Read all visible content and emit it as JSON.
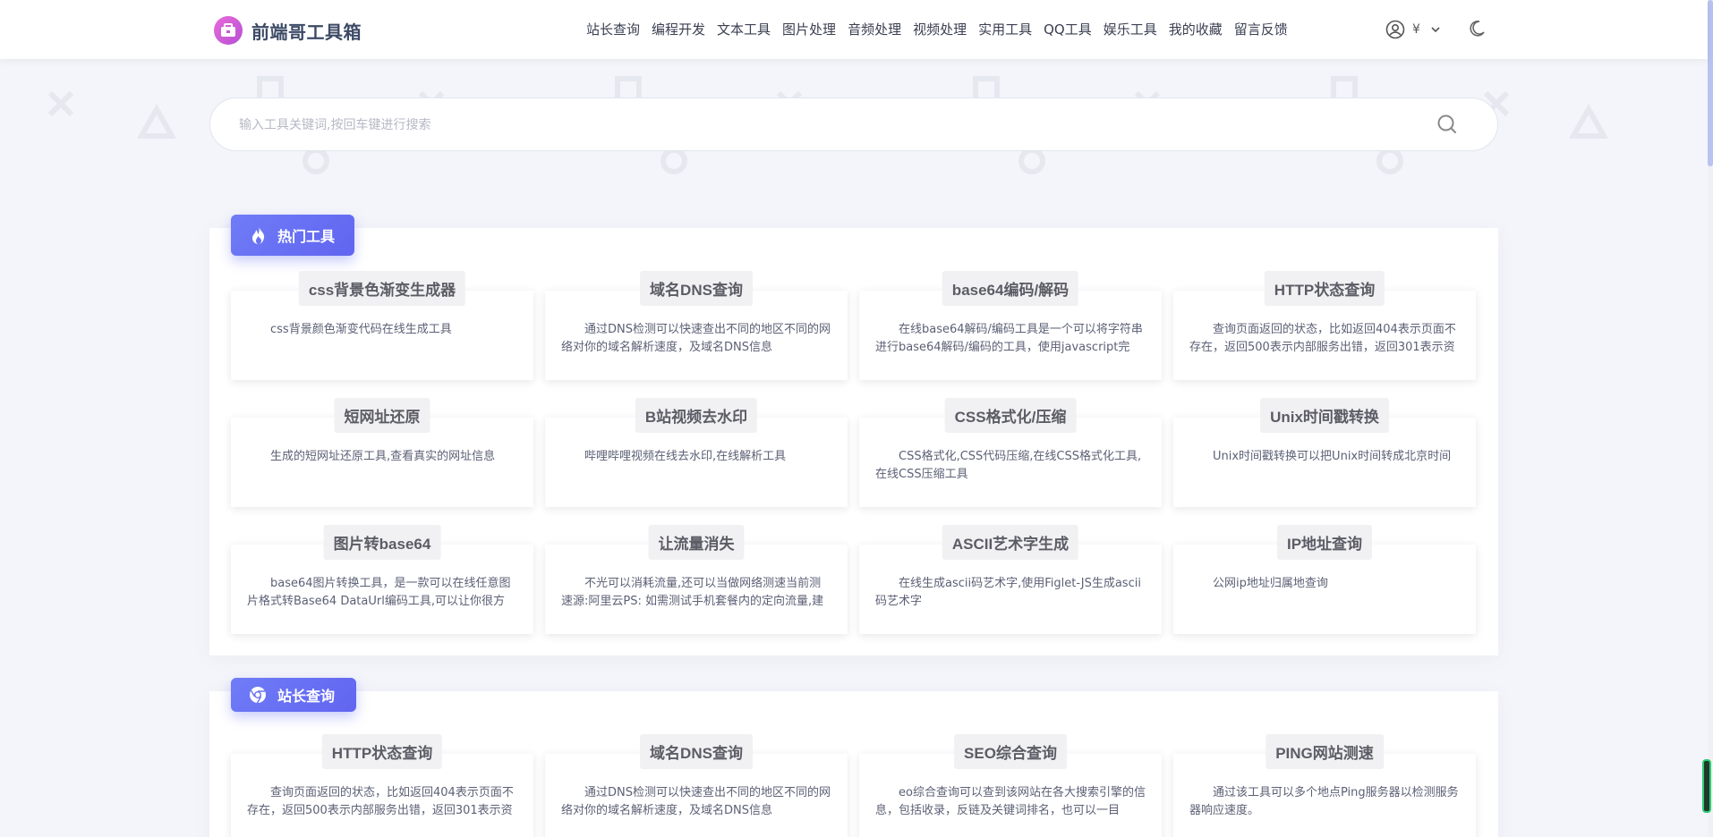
{
  "header": {
    "logo_text": "前端哥工具箱",
    "nav": [
      "站长查询",
      "编程开发",
      "文本工具",
      "图片处理",
      "音频处理",
      "视频处理",
      "实用工具",
      "QQ工具",
      "娱乐工具",
      "我的收藏",
      "留言反馈"
    ],
    "currency": "¥"
  },
  "search": {
    "placeholder": "输入工具关键词,按回车键进行搜索"
  },
  "sections": [
    {
      "title": "热门工具",
      "icon": "fire-icon",
      "cards": [
        {
          "title": "css背景色渐变生成器",
          "desc": "css背景颜色渐变代码在线生成工具"
        },
        {
          "title": "域名DNS查询",
          "desc": "通过DNS检测可以快速查出不同的地区不同的网络对你的域名解析速度，及域名DNS信息"
        },
        {
          "title": "base64编码/解码",
          "desc": "在线base64解码/编码工具是一个可以将字符串进行base64解码/编码的工具，使用javascript完"
        },
        {
          "title": "HTTP状态查询",
          "desc": "查询页面返回的状态，比如返回404表示页面不存在，返回500表示内部服务出错，返回301表示资"
        },
        {
          "title": "短网址还原",
          "desc": "生成的短网址还原工具,查看真实的网址信息"
        },
        {
          "title": "B站视频去水印",
          "desc": "哔哩哔哩视频在线去水印,在线解析工具"
        },
        {
          "title": "CSS格式化/压缩",
          "desc": "CSS格式化,CSS代码压缩,在线CSS格式化工具,在线CSS压缩工具"
        },
        {
          "title": "Unix时间戳转换",
          "desc": "Unix时间戳转换可以把Unix时间转成北京时间"
        },
        {
          "title": "图片转base64",
          "desc": "base64图片转换工具，是一款可以在线任意图片格式转Base64 DataUrl编码工具,可以让你很方"
        },
        {
          "title": "让流量消失",
          "desc": "不光可以消耗流量,还可以当做网络测速当前测速源:阿里云PS: 如需测试手机套餐内的定向流量,建"
        },
        {
          "title": "ASCII艺术字生成",
          "desc": "在线生成ascii码艺术字,使用Figlet-JS生成ascii码艺术字"
        },
        {
          "title": "IP地址查询",
          "desc": "公网ip地址归属地查询"
        }
      ]
    },
    {
      "title": "站长查询",
      "icon": "chrome-icon",
      "cards": [
        {
          "title": "HTTP状态查询",
          "desc": "查询页面返回的状态，比如返回404表示页面不存在，返回500表示内部服务出错，返回301表示资"
        },
        {
          "title": "域名DNS查询",
          "desc": "通过DNS检测可以快速查出不同的地区不同的网络对你的域名解析速度，及域名DNS信息"
        },
        {
          "title": "SEO综合查询",
          "desc": "eo综合查询可以查到该网站在各大搜索引擎的信息，包括收录，反链及关键词排名，也可以一目"
        },
        {
          "title": "PING网站测速",
          "desc": "通过该工具可以多个地点Ping服务器以检测服务器响应速度。"
        }
      ]
    }
  ]
}
